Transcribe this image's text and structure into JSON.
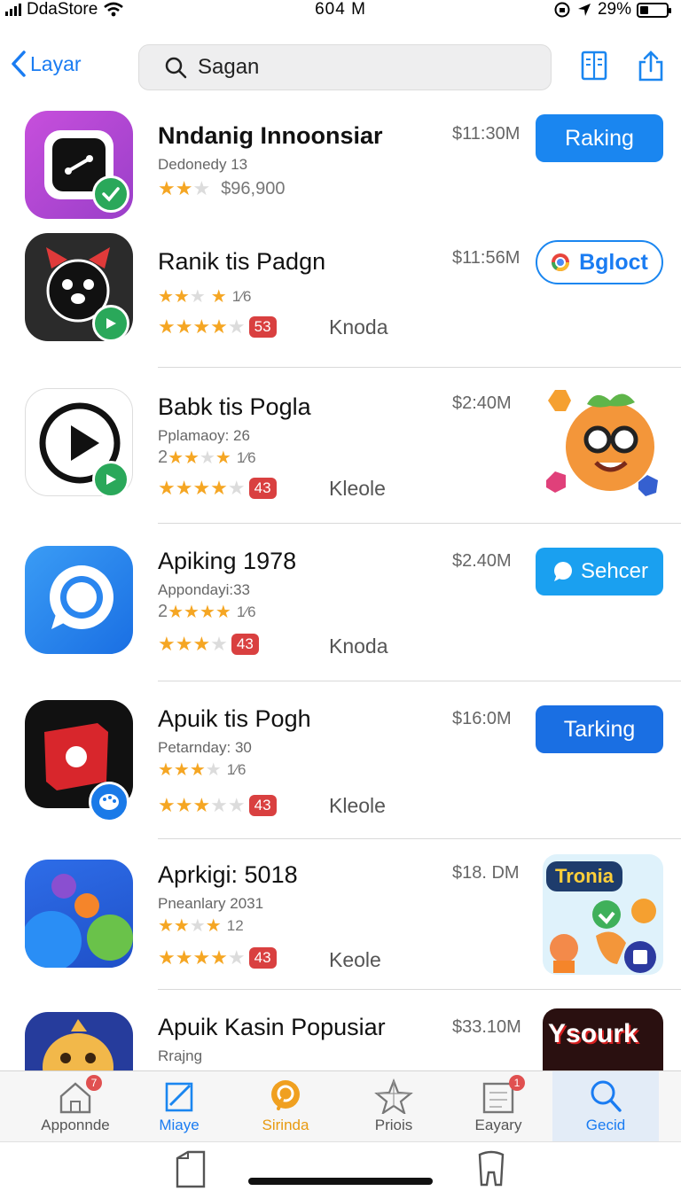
{
  "status": {
    "carrier": "DdaStore",
    "time": "604 M",
    "battery": "29%",
    "battery_level": 0.29
  },
  "nav": {
    "back_label": "Layar",
    "search_value": "Sagan"
  },
  "apps": [
    {
      "name": "Nndanig Innoonsiar",
      "sub": "Dedonedy 13",
      "price": "$11:30M",
      "rating_text": "$96,900",
      "button": "Raking"
    },
    {
      "name": "Ranik tis Padgn",
      "rating_line1": "1⁄6",
      "badge": "53",
      "tag": "Knoda",
      "price": "$11:56M",
      "button": "Bgloct"
    },
    {
      "name": "Babk tis Pogla",
      "sub": "Pplamaoy: 26",
      "rating_line1": "2",
      "rating_line1_suffix": "1⁄6",
      "badge": "43",
      "tag": "Kleole",
      "price": "$2:40M"
    },
    {
      "name": "Apiking 1978",
      "sub": "Appondayi:33",
      "rating_line1": "2",
      "rating_line1_suffix": "1⁄6",
      "badge": "43",
      "tag": "Knoda",
      "price": "$2.40M",
      "button": "Sehcer"
    },
    {
      "name": "Apuik tis Pogh",
      "sub": "Petarnday: 30",
      "rating_line1_suffix": "1⁄6",
      "badge": "43",
      "tag": "Kleole",
      "price": "$16:0M",
      "button": "Tarking"
    },
    {
      "name": "Aprkigi: 5018",
      "sub": "Pneanlary 2031",
      "rating_line1_suffix": "12",
      "badge": "43",
      "tag": "Keole",
      "price": "$18. DM",
      "promo_label": "Tronia"
    },
    {
      "name": "Apuik Kasin Popusiar",
      "sub": "Rrajng",
      "price": "$33.10M",
      "promo_label": "Ysourk"
    }
  ],
  "tabs": [
    {
      "label": "Apponnde",
      "badge": "7"
    },
    {
      "label": "Miaye"
    },
    {
      "label": "Sirinda"
    },
    {
      "label": "Priois"
    },
    {
      "label": "Eayary",
      "badge": "1"
    },
    {
      "label": "Gecid"
    }
  ],
  "colors": {
    "accent": "#1a86f0",
    "star": "#f5a623",
    "badge_red": "#d94040",
    "active_tab": "#f0a020"
  }
}
